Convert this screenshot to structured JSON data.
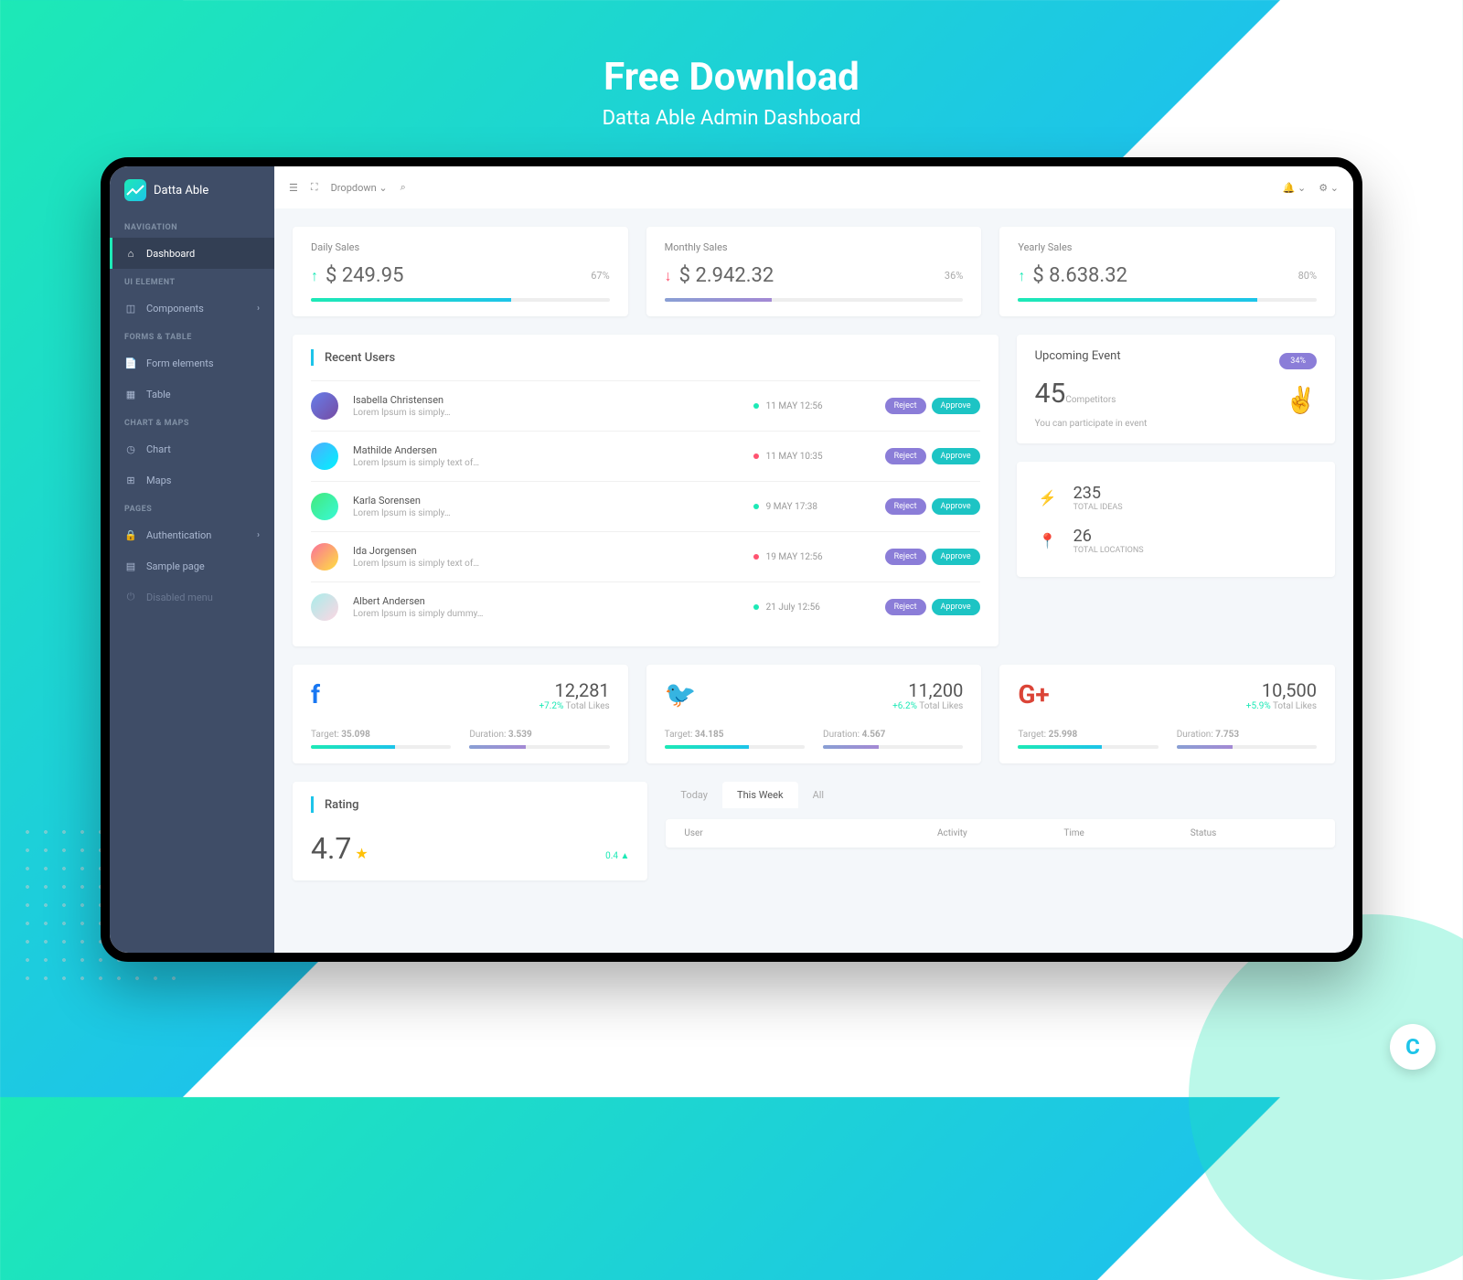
{
  "hero": {
    "title": "Free Download",
    "subtitle": "Datta Able Admin Dashboard"
  },
  "brand": "Datta Able",
  "sidebar": {
    "sections": [
      {
        "label": "NAVIGATION",
        "items": [
          {
            "label": "Dashboard",
            "icon": "home",
            "active": true
          }
        ]
      },
      {
        "label": "UI ELEMENT",
        "items": [
          {
            "label": "Components",
            "icon": "box",
            "chevron": true
          }
        ]
      },
      {
        "label": "FORMS & TABLE",
        "items": [
          {
            "label": "Form elements",
            "icon": "file"
          },
          {
            "label": "Table",
            "icon": "table"
          }
        ]
      },
      {
        "label": "CHART & MAPS",
        "items": [
          {
            "label": "Chart",
            "icon": "clock"
          },
          {
            "label": "Maps",
            "icon": "map"
          }
        ]
      },
      {
        "label": "PAGES",
        "items": [
          {
            "label": "Authentication",
            "icon": "lock",
            "chevron": true
          },
          {
            "label": "Sample page",
            "icon": "page"
          },
          {
            "label": "Disabled menu",
            "icon": "power",
            "disabled": true
          }
        ]
      }
    ]
  },
  "topbar": {
    "dropdown": "Dropdown"
  },
  "sales": [
    {
      "label": "Daily Sales",
      "value": "$ 249.95",
      "pct": "67%",
      "dir": "up",
      "bar": 67,
      "color": "teal"
    },
    {
      "label": "Monthly Sales",
      "value": "$ 2.942.32",
      "pct": "36%",
      "dir": "down",
      "bar": 36,
      "color": "purple"
    },
    {
      "label": "Yearly Sales",
      "value": "$ 8.638.32",
      "pct": "80%",
      "dir": "up",
      "bar": 80,
      "color": "teal"
    }
  ],
  "recentUsers": {
    "title": "Recent Users",
    "rows": [
      {
        "name": "Isabella Christensen",
        "desc": "Lorem Ipsum is simply…",
        "date": "11 MAY 12:56",
        "dot": "green"
      },
      {
        "name": "Mathilde Andersen",
        "desc": "Lorem Ipsum is simply text of…",
        "date": "11 MAY 10:35",
        "dot": "red"
      },
      {
        "name": "Karla Sorensen",
        "desc": "Lorem Ipsum is simply…",
        "date": "9 MAY 17:38",
        "dot": "green"
      },
      {
        "name": "Ida Jorgensen",
        "desc": "Lorem Ipsum is simply text of…",
        "date": "19 MAY 12:56",
        "dot": "red"
      },
      {
        "name": "Albert Andersen",
        "desc": "Lorem Ipsum is simply dummy…",
        "date": "21 July 12:56",
        "dot": "green"
      }
    ],
    "reject": "Reject",
    "approve": "Approve"
  },
  "event": {
    "title": "Upcoming Event",
    "badge": "34%",
    "value": "45",
    "label": "Competitors",
    "note": "You can participate in event"
  },
  "stats": [
    {
      "value": "235",
      "label": "TOTAL IDEAS",
      "icon": "bolt"
    },
    {
      "value": "26",
      "label": "TOTAL LOCATIONS",
      "icon": "pin"
    }
  ],
  "social": [
    {
      "icon": "f",
      "cls": "fb",
      "number": "12,281",
      "change": "+7.2%",
      "sub": "Total Likes",
      "target": "35.098",
      "duration": "3.539"
    },
    {
      "icon": "🐦",
      "cls": "tw",
      "number": "11,200",
      "change": "+6.2%",
      "sub": "Total Likes",
      "target": "34.185",
      "duration": "4.567"
    },
    {
      "icon": "G+",
      "cls": "gp",
      "number": "10,500",
      "change": "+5.9%",
      "sub": "Total Likes",
      "target": "25.998",
      "duration": "7.753"
    }
  ],
  "rating": {
    "title": "Rating",
    "value": "4.7",
    "change": "0.4 ▲"
  },
  "tabs": {
    "today": "Today",
    "week": "This Week",
    "all": "All"
  },
  "tableHead": {
    "user": "User",
    "activity": "Activity",
    "time": "Time",
    "status": "Status"
  },
  "targetLabel": "Target:",
  "durationLabel": "Duration:"
}
